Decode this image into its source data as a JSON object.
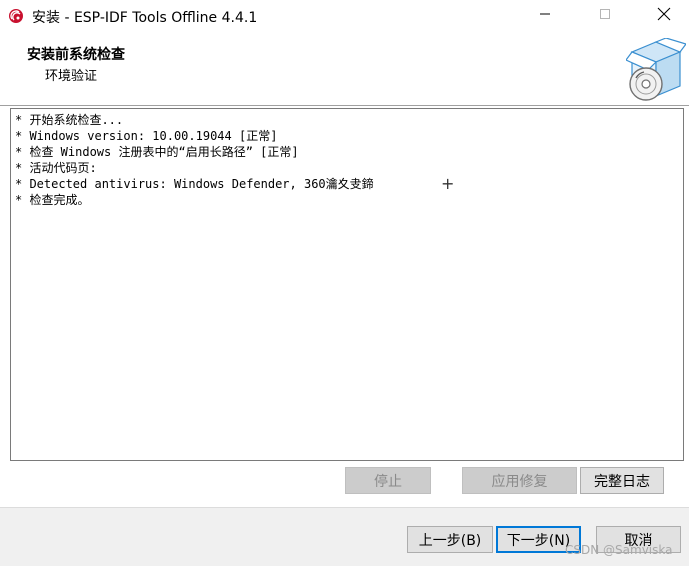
{
  "window": {
    "title": "安装 - ESP-IDF Tools Offline 4.4.1",
    "icon": "esp-idf-logo-icon",
    "controls": [
      "minimize-icon",
      "maximize-icon",
      "close-icon"
    ]
  },
  "header": {
    "title": "安装前系统检查",
    "subtitle": "环境验证",
    "image": "installer-box-disc-icon"
  },
  "log": {
    "lines": [
      "* 开始系统检查...",
      "* Windows version: 10.00.19044 [正常]",
      "* 检查 Windows 注册表中的“启用长路径” [正常]",
      "* 活动代码页:",
      "* Detected antivirus: Windows Defender, 360瀹夊叏鍗",
      "* 检查完成。"
    ],
    "cursor": "+"
  },
  "actions": {
    "stop": "停止",
    "apply_fix": "应用修复",
    "full_log": "完整日志"
  },
  "nav": {
    "back": "上一步(B)",
    "next": "下一步(N)",
    "cancel": "取消"
  },
  "watermark": "CSDN @Samviska",
  "colors": {
    "accent": "#0078d7",
    "logo_red": "#c8102e",
    "box_blue": "#3a8fd0",
    "disabled_bg": "#cccccc",
    "footer_bg": "#f0f0f0"
  }
}
